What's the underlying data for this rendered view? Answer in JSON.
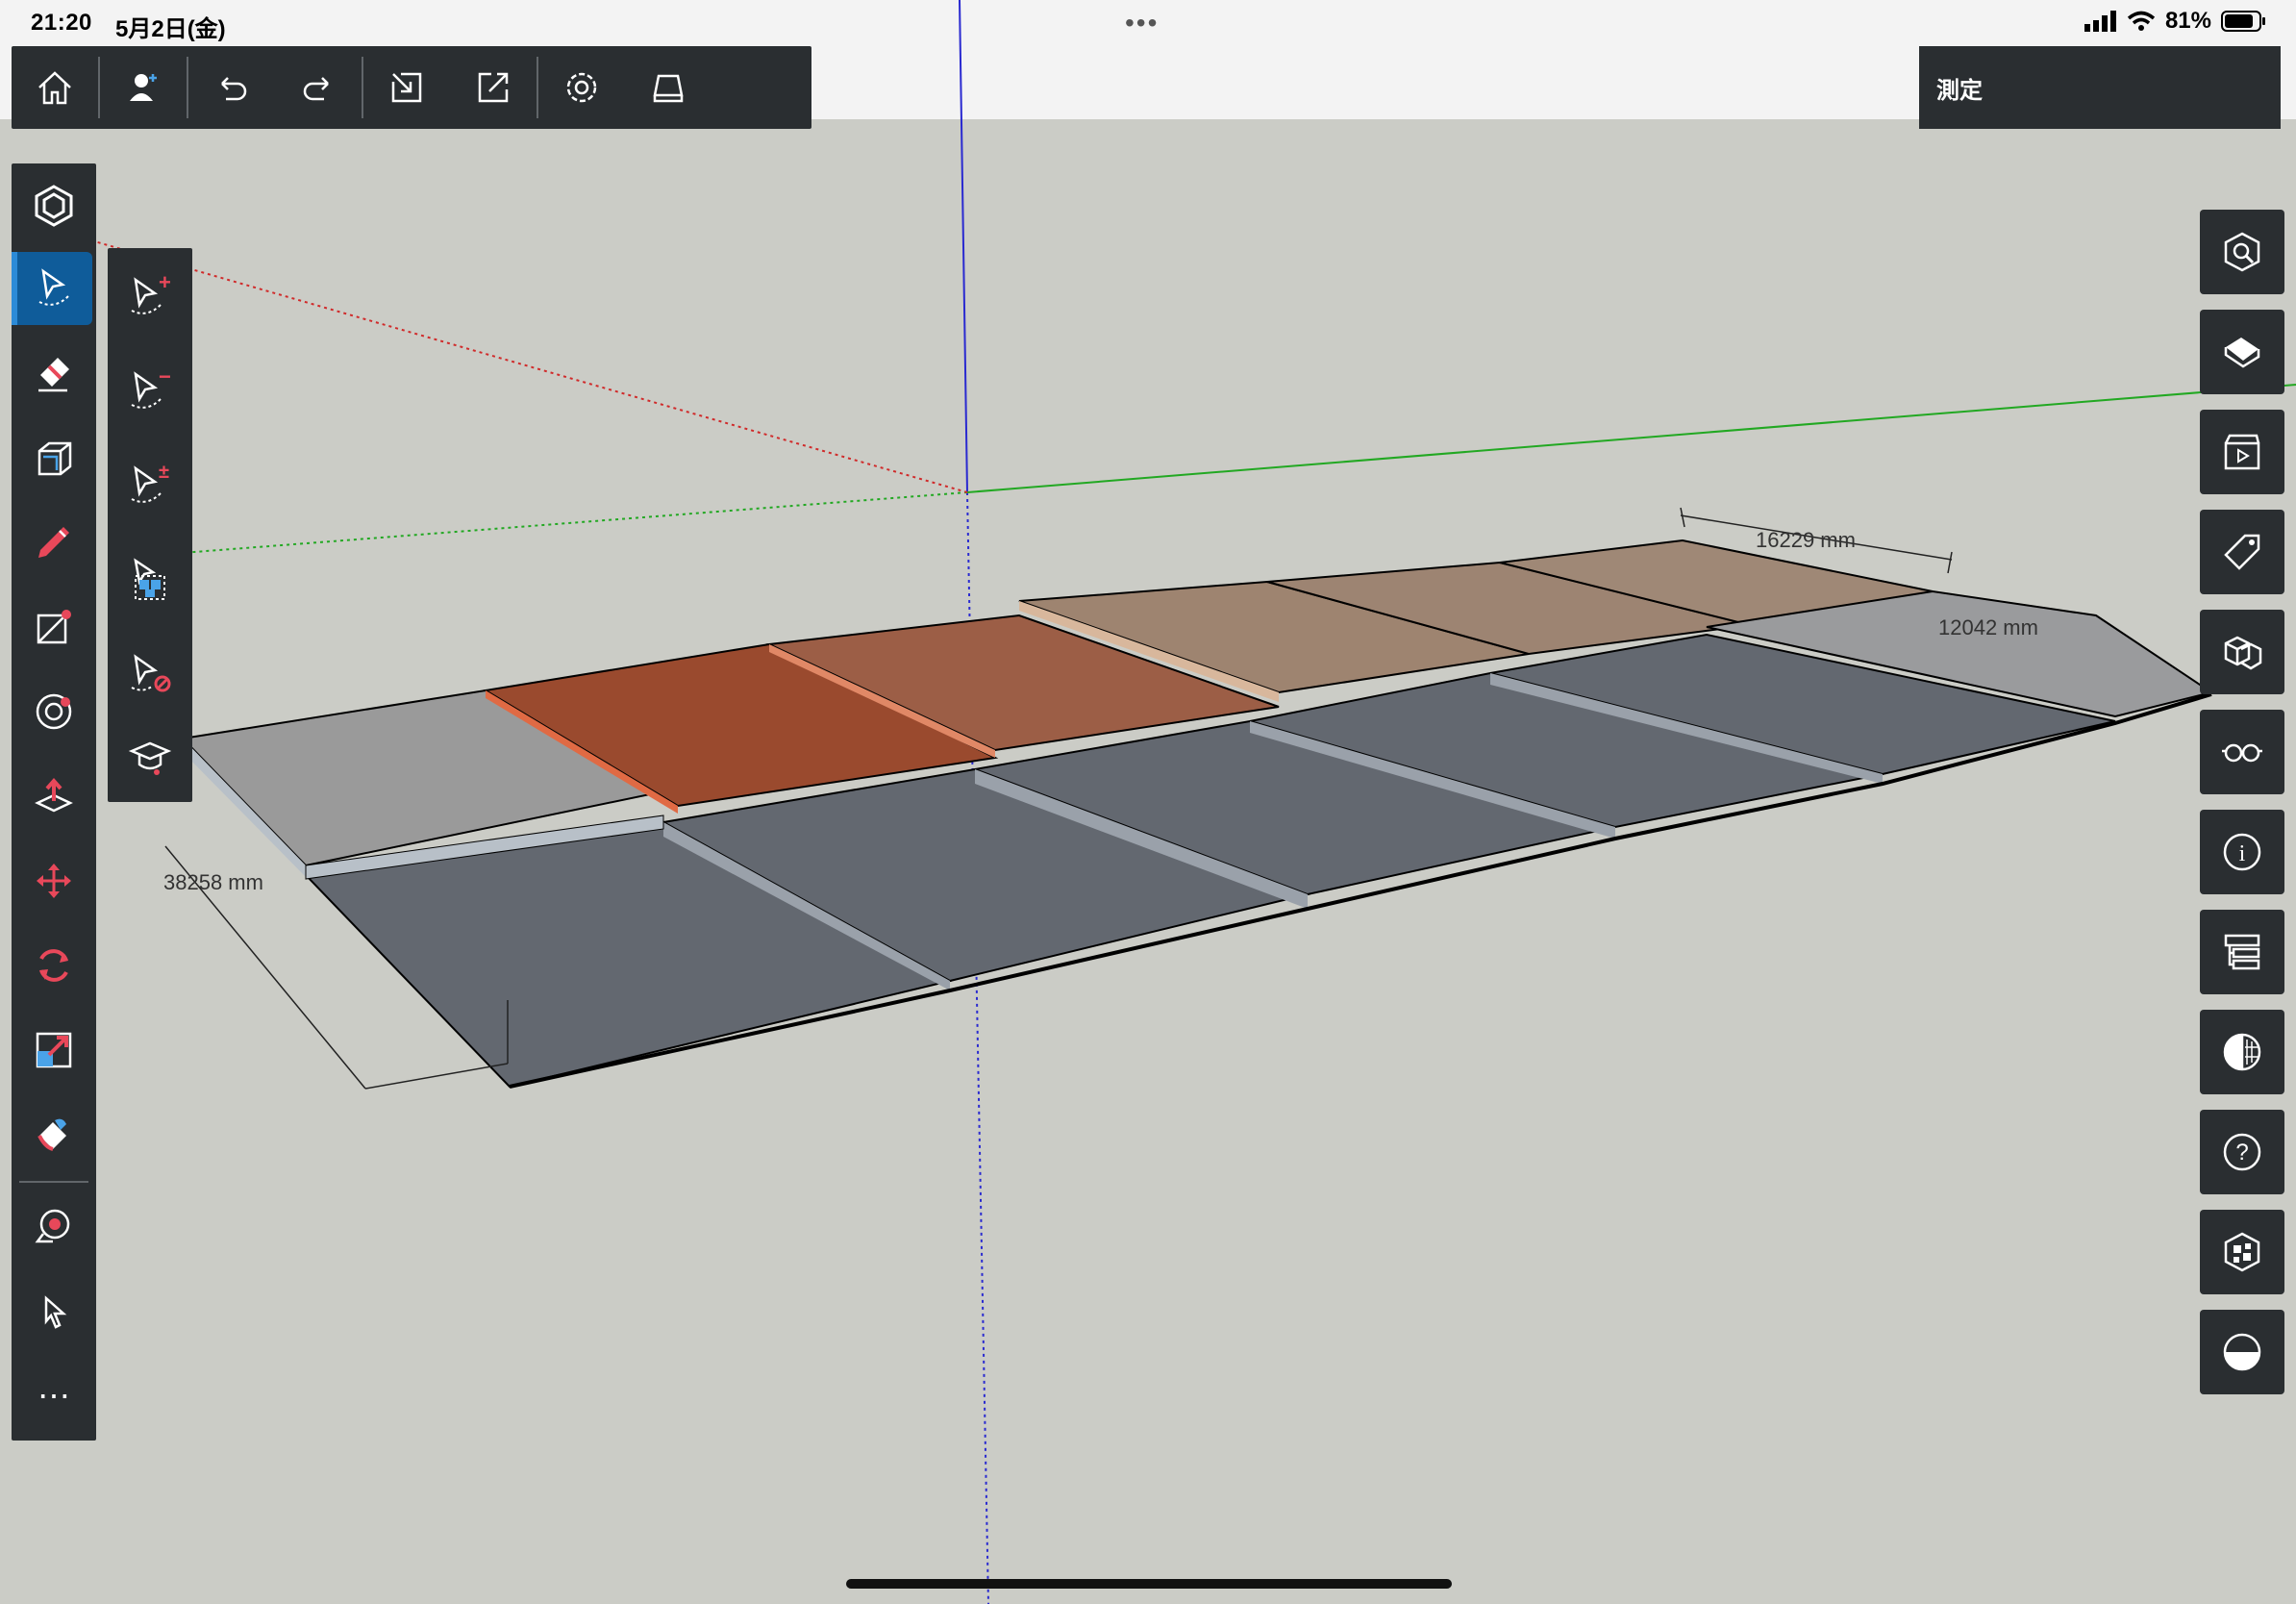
{
  "status_bar": {
    "time": "21:20",
    "date": "5月2日(金)",
    "menu_dots": "•••",
    "battery_percent": "81%"
  },
  "top_toolbar": {
    "buttons": [
      {
        "name": "home",
        "icon": "home-icon"
      },
      {
        "name": "account",
        "icon": "user-add-icon"
      },
      {
        "name": "undo",
        "icon": "undo-icon"
      },
      {
        "name": "redo",
        "icon": "redo-icon"
      },
      {
        "name": "import",
        "icon": "import-icon"
      },
      {
        "name": "export",
        "icon": "export-icon"
      },
      {
        "name": "settings",
        "icon": "gear-icon"
      },
      {
        "name": "storage",
        "icon": "drive-icon"
      }
    ]
  },
  "tool_panel": {
    "title": "測定"
  },
  "left_toolbar": {
    "tools": [
      "search-model-icon",
      "select-tool-icon",
      "eraser-icon",
      "box-tool-icon",
      "pencil-icon",
      "shape-tool-icon",
      "offset-tool-icon",
      "push-pull-icon",
      "move-icon",
      "rotate-icon",
      "scale-icon",
      "paint-bucket-icon",
      "tape-measure-icon",
      "pointer-icon",
      "more-icon"
    ],
    "more_label": "⋯"
  },
  "select_submenu": {
    "items": [
      "select-add-icon",
      "select-subtract-icon",
      "select-toggle-icon",
      "select-group-icon",
      "select-none-icon",
      "instructor-icon"
    ],
    "add_sign": "+",
    "subtract_sign": "−",
    "toggle_sign": "±"
  },
  "right_toolbar": {
    "buttons": [
      "search-3d-icon",
      "views-icon",
      "scenes-icon",
      "tags-icon",
      "components-icon",
      "xray-glasses-icon",
      "info-icon",
      "outliner-icon",
      "styles-icon",
      "help-icon",
      "materials-icon",
      "shadows-icon"
    ],
    "info_glyph": "i",
    "help_glyph": "?"
  },
  "dimensions": {
    "width": "16229 mm",
    "depth": "12042 mm",
    "length": "38258 mm"
  },
  "colors": {
    "toolbar_bg": "#2a2e31",
    "active_blue": "#0f5c9a",
    "accent_red": "#e8485a",
    "sky": "#cbccc6"
  }
}
